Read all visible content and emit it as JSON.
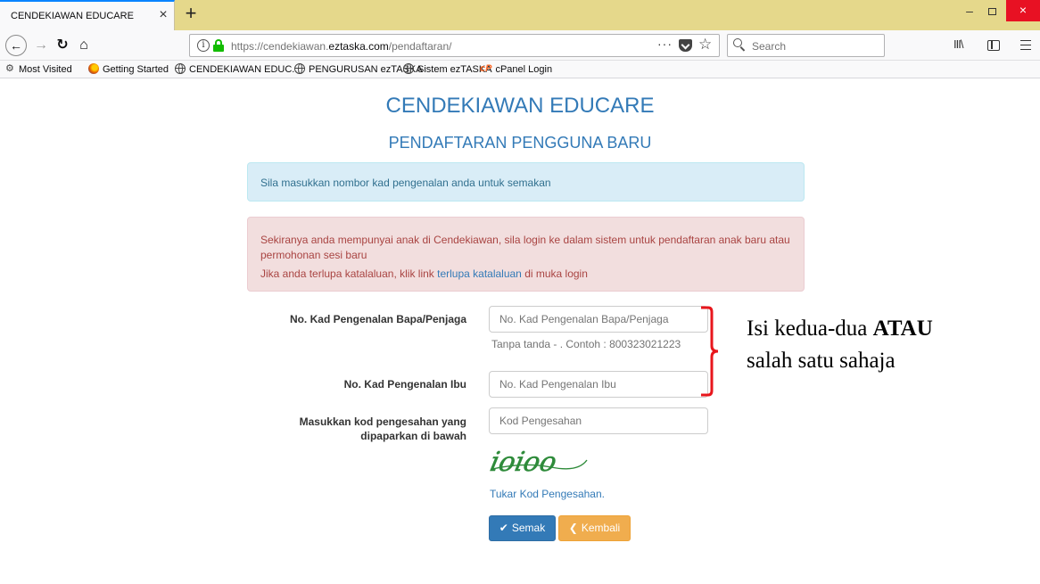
{
  "browser": {
    "tab_title": "CENDEKIAWAN EDUCARE",
    "tab_close": "×",
    "new_tab": "+",
    "window_min": "–",
    "window_close": "×",
    "url_prefix": "https://cendekiawan.",
    "url_host": "eztaska.com",
    "url_path": "/pendaftaran/",
    "url_more": "···",
    "search_placeholder": "Search",
    "library": "III\\",
    "bookmarks": [
      {
        "label": "Most Visited",
        "icon": "gear-icon"
      },
      {
        "label": "Getting Started",
        "icon": "firefox-icon"
      },
      {
        "label": "CENDEKIAWAN EDUC...",
        "icon": "globe-icon"
      },
      {
        "label": "PENGURUSAN ezTASKA",
        "icon": "globe-icon"
      },
      {
        "label": "Sistem ezTASKA",
        "icon": "globe-icon"
      },
      {
        "label": "cPanel Login",
        "icon": "cpanel-icon"
      }
    ]
  },
  "page": {
    "site_title": "CENDEKIAWAN EDUCARE",
    "subtitle": "PENDAFTARAN PENGGUNA BARU",
    "info_alert": "Sila masukkan nombor kad pengenalan anda untuk semakan",
    "danger_alert": {
      "line1": "Sekiranya anda mempunyai anak di Cendekiawan, sila login ke dalam sistem untuk pendaftaran anak baru atau permohonan sesi baru",
      "line2_before": "Jika anda terlupa katalaluan, klik link ",
      "line2_link": "terlupa katalaluan",
      "line2_after": " di muka login"
    }
  },
  "form": {
    "father_label": "No. Kad Pengenalan Bapa/Penjaga",
    "father_placeholder": "No. Kad Pengenalan Bapa/Penjaga",
    "father_help": "Tanpa tanda - . Contoh : 800323021223",
    "mother_label": "No. Kad Pengenalan Ibu",
    "mother_placeholder": "No. Kad Pengenalan Ibu",
    "code_label_line1": "Masukkan kod pengesahan yang",
    "code_label_line2": "dipaparkan di bawah",
    "code_placeholder": "Kod Pengesahan",
    "captcha_text": "ioioo",
    "captcha_link": "Tukar Kod Pengesahan.",
    "check_button": "Semak",
    "back_button": "Kembali"
  },
  "annotation": {
    "line1_before": "Isi kedua-dua ",
    "line1_bold": "ATAU",
    "line2": "salah satu sahaja"
  },
  "colors": {
    "tab_bar": "#e5d88b",
    "primary": "#337ab7",
    "info_bg": "#d9edf7",
    "danger_bg": "#f2dede",
    "warning": "#f0ad4e",
    "bracket": "#e8161c",
    "captcha": "#2e8b3a"
  }
}
